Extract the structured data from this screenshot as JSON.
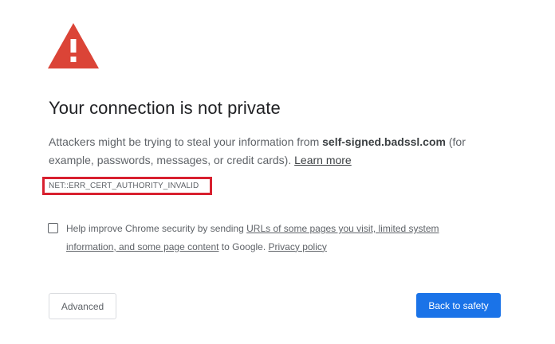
{
  "interstitial": {
    "title": "Your connection is not private",
    "description": {
      "prefix": "Attackers might be trying to steal your information from ",
      "host": "self-signed.badssl.com",
      "suffix": " (for example, passwords, messages, or credit cards). ",
      "learn_more": "Learn more"
    },
    "error_code": "NET::ERR_CERT_AUTHORITY_INVALID",
    "opt_in": {
      "prefix": "Help improve Chrome security by sending ",
      "link": "URLs of some pages you visit, limited system information, and some page content",
      "middle": " to Google. ",
      "privacy_link": "Privacy policy",
      "checked": false
    },
    "buttons": {
      "advanced": "Advanced",
      "back_to_safety": "Back to safety"
    },
    "colors": {
      "warning_red": "#db4437",
      "error_outline": "#d8202f",
      "primary_blue": "#1a73e8"
    },
    "icons": {
      "warning": "warning-triangle-icon"
    }
  }
}
